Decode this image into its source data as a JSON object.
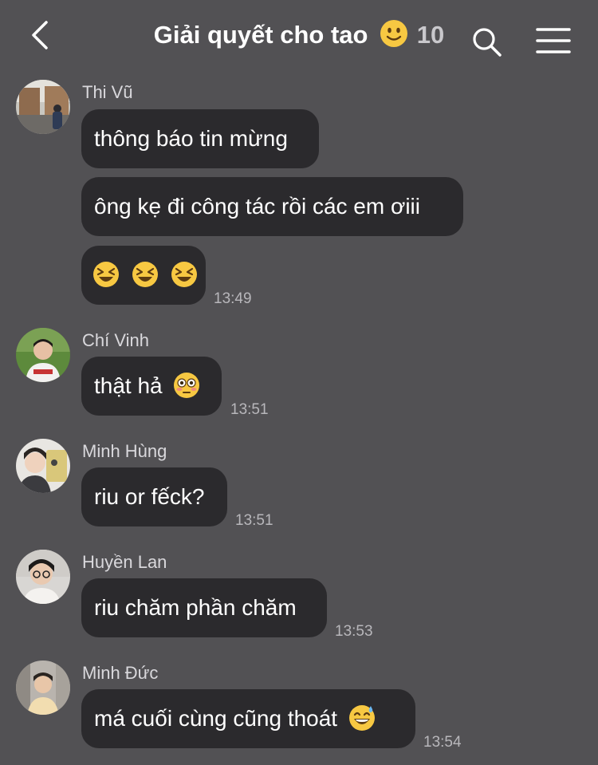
{
  "header": {
    "title": "Giải quyết cho tao",
    "title_emoji": "slightly-smiling-face",
    "member_count": "10",
    "back_icon": "chevron-left-icon",
    "search_icon": "search-icon",
    "menu_icon": "hamburger-menu-icon"
  },
  "messages": [
    {
      "sender": "Thi Vũ",
      "bubbles": [
        "thông báo tin mừng",
        "ông kẹ đi công tác rồi các em ơiii",
        "laughing-emoji x3"
      ],
      "time": "13:49"
    },
    {
      "sender": "Chí Vinh",
      "bubbles": [
        "thật hả"
      ],
      "emoji": "flushed-face",
      "time": "13:51"
    },
    {
      "sender": "Minh Hùng",
      "bubbles": [
        "riu or fếck?"
      ],
      "time": "13:51"
    },
    {
      "sender": "Huyền Lan",
      "bubbles": [
        "riu chăm phần chăm"
      ],
      "time": "13:53"
    },
    {
      "sender": "Minh Đức",
      "bubbles": [
        "má cuối cùng cũng thoát"
      ],
      "emoji": "grinning-face-with-sweat",
      "time": "13:54"
    }
  ],
  "colors": {
    "background": "#525154",
    "bubble": "#2b2a2d",
    "text": "#ffffff",
    "secondary_text": "#b8b7bb"
  }
}
